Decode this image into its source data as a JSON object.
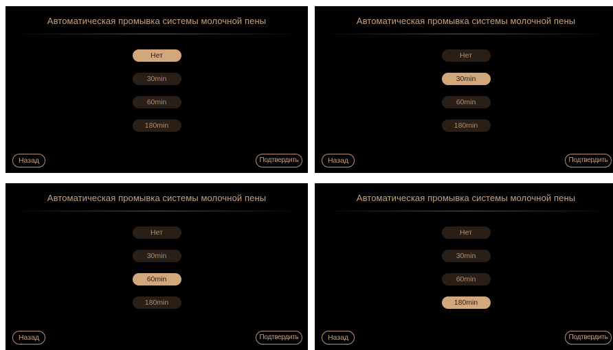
{
  "screen": {
    "title": "Автоматическая промывка системы молочной пены",
    "options": [
      "Нет",
      "30min",
      "60min",
      "180min"
    ],
    "back_label": "Назад",
    "confirm_label": "Подтвердить"
  },
  "panels": [
    {
      "selected_option": "Нет"
    },
    {
      "selected_option": "30min"
    },
    {
      "selected_option": "60min"
    },
    {
      "selected_option": "180min"
    }
  ],
  "colors": {
    "background": "#000000",
    "accent": "#d3a77c",
    "text": "#c9a07a",
    "option_unselected_bg": "#2a1f17"
  }
}
